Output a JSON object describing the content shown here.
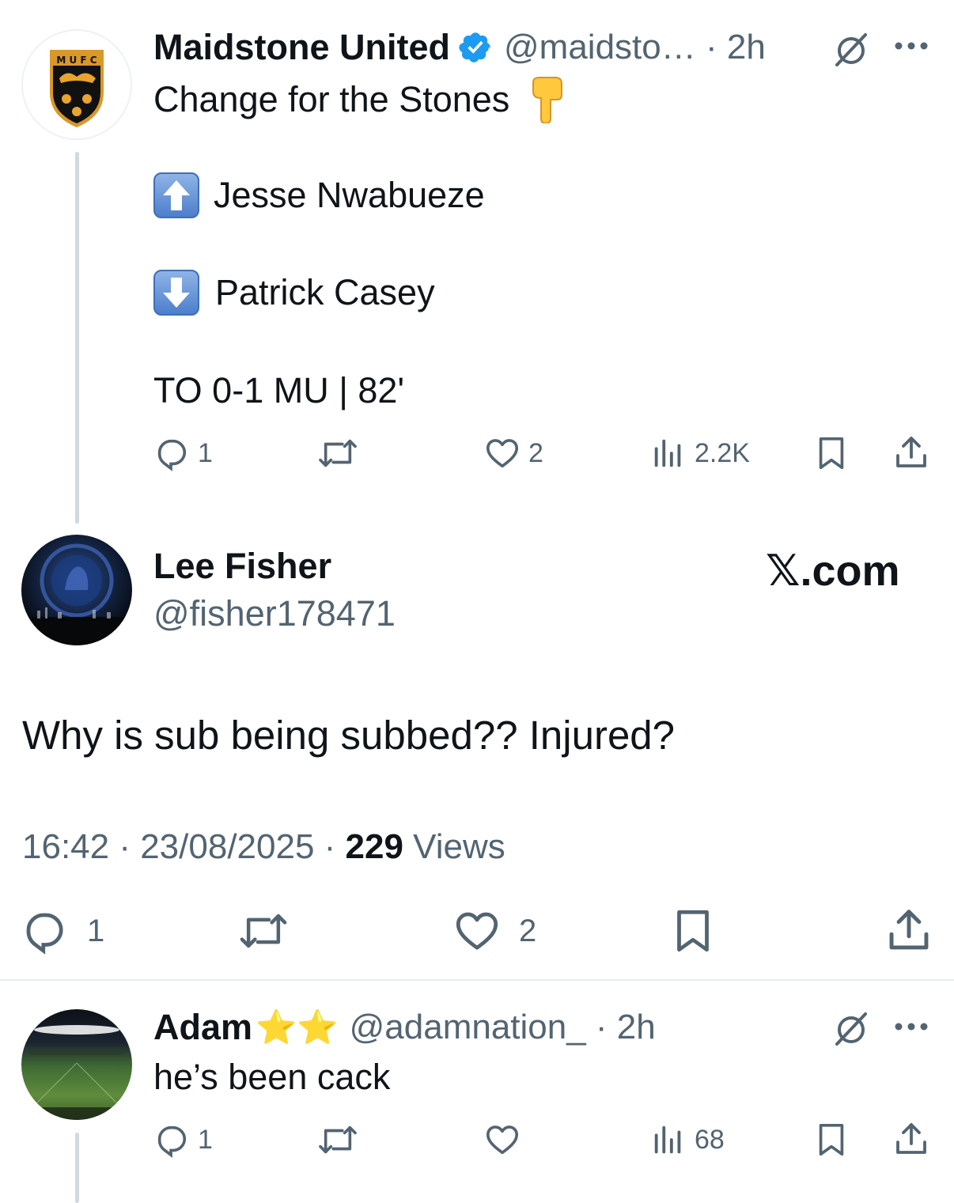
{
  "tweet1": {
    "display_name": "Maidstone United",
    "handle_time": "@maidsto… · 2h",
    "avatar_text": "M U F C",
    "line1": "Change for the Stones",
    "sub_on": "Jesse Nwabueze",
    "sub_off": "Patrick Casey",
    "score_line": "TO 0-1 MU | 82'",
    "replies": "1",
    "likes": "2",
    "views": "2.2K"
  },
  "focus_tweet": {
    "display_name": "Lee Fisher",
    "handle": "@fisher178471",
    "brand": "𝕏.com",
    "text": "Why is sub being subbed?? Injured?",
    "time_date": "16:42 · 23/08/2025 · ",
    "views_count": "229",
    "views_label": " Views",
    "replies": "1",
    "likes": "2"
  },
  "reply": {
    "display_name": "Adam",
    "badges": "⭐⭐",
    "handle_time": "@adamnation_ · 2h",
    "text": "he’s been cack",
    "replies": "1",
    "views": "68"
  },
  "colors": {
    "text": "#0f1419",
    "muted": "#536471",
    "verified": "#1d9bf0",
    "thread_line": "#cfd9de"
  }
}
